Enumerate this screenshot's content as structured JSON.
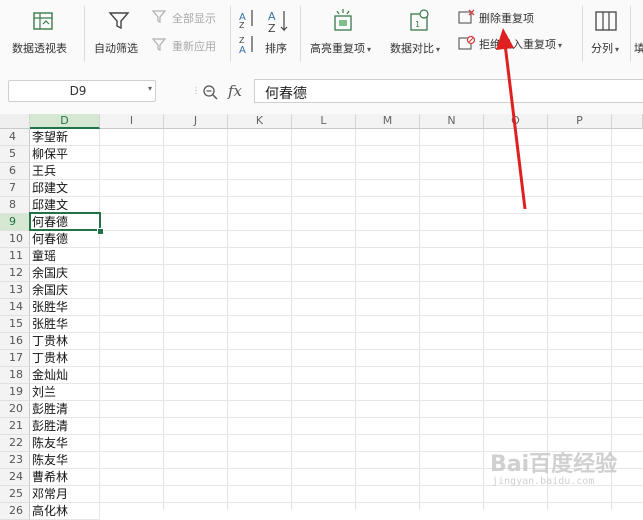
{
  "ribbon": {
    "pivot_label": "数据透视表",
    "autofilter_label": "自动筛选",
    "show_all_label": "全部显示",
    "reapply_label": "重新应用",
    "sort_label": "排序",
    "highlight_dup_label": "高亮重复项",
    "compare_label": "数据对比",
    "remove_dup_label": "删除重复项",
    "reject_dup_label": "拒绝录入重复项",
    "split_label": "分列",
    "next_label": "填"
  },
  "formula_bar": {
    "name_box": "D9",
    "fx_symbol": "fx",
    "content": "何春德"
  },
  "columns": [
    "D",
    "I",
    "J",
    "K",
    "L",
    "M",
    "N",
    "O",
    "P"
  ],
  "rows": [
    {
      "num": "4",
      "d": "李望新"
    },
    {
      "num": "5",
      "d": "柳保平"
    },
    {
      "num": "6",
      "d": "王兵"
    },
    {
      "num": "7",
      "d": "邱建文"
    },
    {
      "num": "8",
      "d": "邱建文"
    },
    {
      "num": "9",
      "d": "何春德"
    },
    {
      "num": "10",
      "d": "何春德"
    },
    {
      "num": "11",
      "d": "童瑶"
    },
    {
      "num": "12",
      "d": "余国庆"
    },
    {
      "num": "13",
      "d": "余国庆"
    },
    {
      "num": "14",
      "d": "张胜华"
    },
    {
      "num": "15",
      "d": "张胜华"
    },
    {
      "num": "16",
      "d": "丁贵林"
    },
    {
      "num": "17",
      "d": "丁贵林"
    },
    {
      "num": "18",
      "d": "金灿灿"
    },
    {
      "num": "19",
      "d": "刘兰"
    },
    {
      "num": "20",
      "d": "彭胜清"
    },
    {
      "num": "21",
      "d": "彭胜清"
    },
    {
      "num": "22",
      "d": "陈友华"
    },
    {
      "num": "23",
      "d": "陈友华"
    },
    {
      "num": "24",
      "d": "曹希林"
    },
    {
      "num": "25",
      "d": "邓常月"
    },
    {
      "num": "26",
      "d": "高化林"
    }
  ],
  "selected_row": "9",
  "colors": {
    "accent": "#217346",
    "arrow": "#e02020"
  },
  "watermark": {
    "logo": "Bai百度经验",
    "url": "jingyan.baidu.com"
  }
}
